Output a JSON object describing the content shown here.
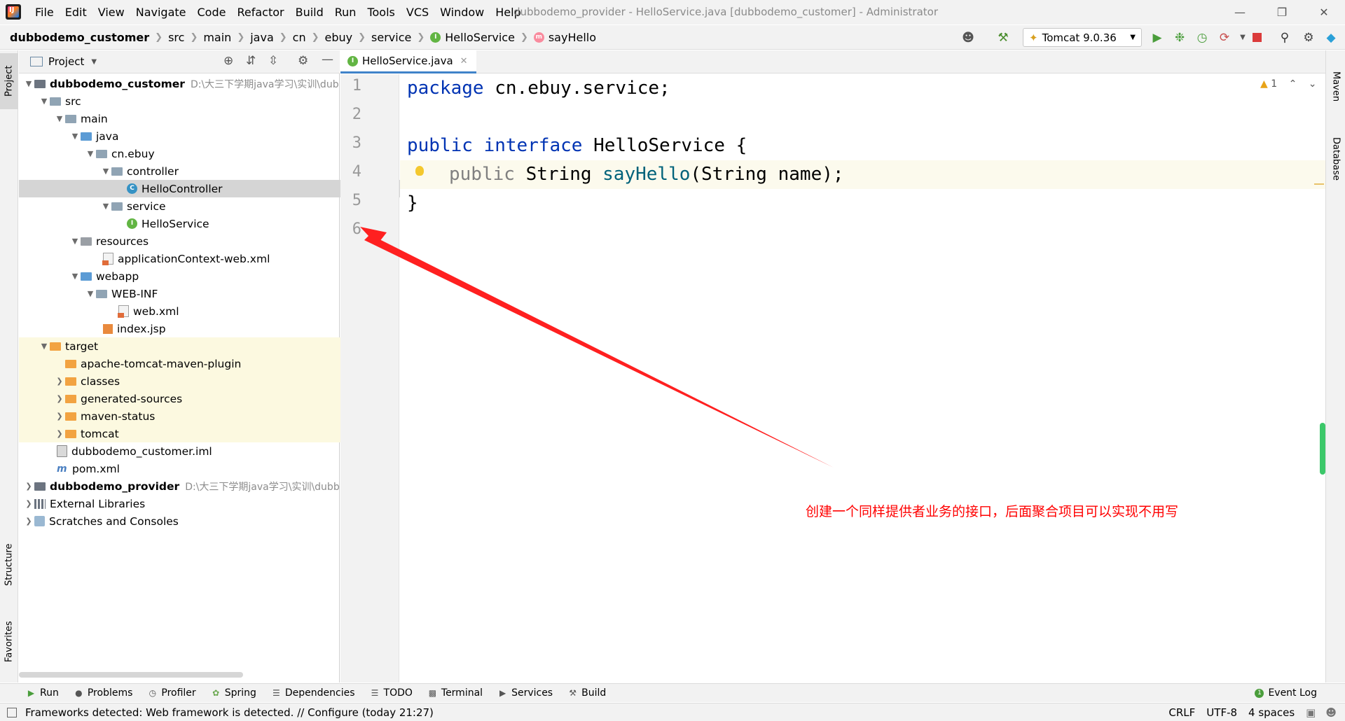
{
  "titlebar": {
    "menu": [
      "File",
      "Edit",
      "View",
      "Navigate",
      "Code",
      "Refactor",
      "Build",
      "Run",
      "Tools",
      "VCS",
      "Window",
      "Help"
    ],
    "window_title": "dubbodemo_provider - HelloService.java [dubbodemo_customer] - Administrator"
  },
  "navbar": {
    "breadcrumbs": [
      "dubbodemo_customer",
      "src",
      "main",
      "java",
      "cn",
      "ebuy",
      "service",
      "HelloService",
      "sayHello"
    ],
    "run_config": "Tomcat 9.0.36"
  },
  "left_stripe": {
    "project": "Project",
    "structure": "Structure",
    "favorites": "Favorites"
  },
  "right_stripe": {
    "maven": "Maven",
    "database": "Database"
  },
  "project_panel": {
    "title": "Project",
    "tree": [
      {
        "label": "dubbodemo_customer",
        "hint": "D:\\大三下学期java学习\\实训\\dub"
      },
      {
        "label": "src"
      },
      {
        "label": "main"
      },
      {
        "label": "java"
      },
      {
        "label": "cn.ebuy"
      },
      {
        "label": "controller"
      },
      {
        "label": "HelloController"
      },
      {
        "label": "service"
      },
      {
        "label": "HelloService"
      },
      {
        "label": "resources"
      },
      {
        "label": "applicationContext-web.xml"
      },
      {
        "label": "webapp"
      },
      {
        "label": "WEB-INF"
      },
      {
        "label": "web.xml"
      },
      {
        "label": "index.jsp"
      },
      {
        "label": "target"
      },
      {
        "label": "apache-tomcat-maven-plugin"
      },
      {
        "label": "classes"
      },
      {
        "label": "generated-sources"
      },
      {
        "label": "maven-status"
      },
      {
        "label": "tomcat"
      },
      {
        "label": "dubbodemo_customer.iml"
      },
      {
        "label": "pom.xml"
      },
      {
        "label": "dubbodemo_provider",
        "hint": "D:\\大三下学期java学习\\实训\\dubb"
      },
      {
        "label": "External Libraries"
      },
      {
        "label": "Scratches and Consoles"
      }
    ]
  },
  "editor": {
    "tab": "HelloService.java",
    "warning_count": "1",
    "line_numbers": [
      "1",
      "2",
      "3",
      "4",
      "5",
      "6"
    ],
    "code": {
      "l1_kw": "package",
      "l1_rest": " cn.ebuy.service;",
      "l3_kw1": "public",
      "l3_kw2": "interface",
      "l3_rest": " HelloService {",
      "l4_kw": "public",
      "l4_type": " String ",
      "l4_fn": "sayHello",
      "l4_rest": "(String name);",
      "l5": "}"
    }
  },
  "annotation": {
    "text": "创建一个同样提供者业务的接口，后面聚合项目可以实现不用写",
    "color": "#ff0000"
  },
  "bottom_bar": {
    "tabs": [
      "Run",
      "Problems",
      "Profiler",
      "Spring",
      "Dependencies",
      "TODO",
      "Terminal",
      "Services",
      "Build"
    ],
    "event_log": "Event Log"
  },
  "status_bar": {
    "message": "Frameworks detected: Web framework is detected. // Configure (today 21:27)",
    "line_sep": "CRLF",
    "encoding": "UTF-8",
    "indent": "4 spaces"
  }
}
